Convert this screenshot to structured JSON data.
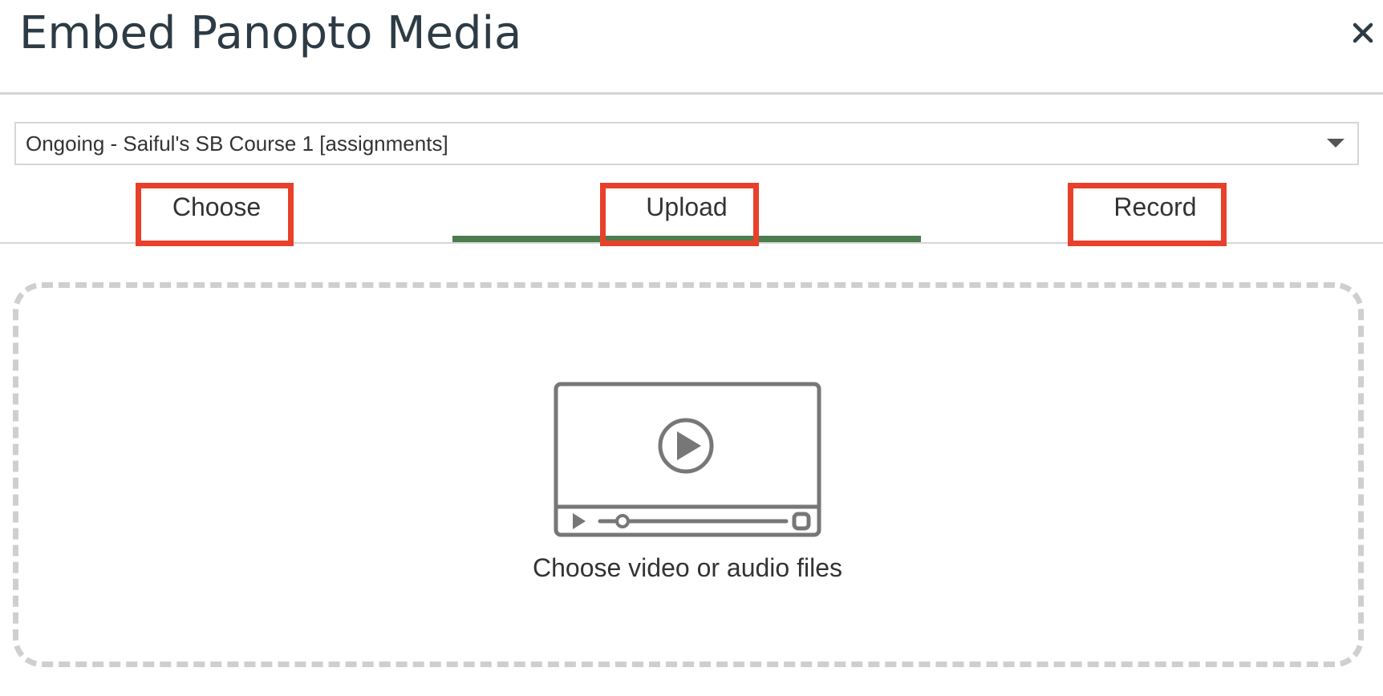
{
  "dialog": {
    "title": "Embed Panopto Media",
    "close_label": "×"
  },
  "course_select": {
    "selected": "Ongoing - Saiful's SB Course 1 [assignments]"
  },
  "tabs": [
    {
      "label": "Choose",
      "active": false
    },
    {
      "label": "Upload",
      "active": true
    },
    {
      "label": "Record",
      "active": false
    }
  ],
  "drop_zone": {
    "text": "Choose video or audio files",
    "icon": "video-player-icon"
  },
  "colors": {
    "active_tab_underline": "#4b7d4e",
    "highlight": "#e8402a",
    "dashed_border": "#cfcfcf",
    "icon": "#777777"
  }
}
